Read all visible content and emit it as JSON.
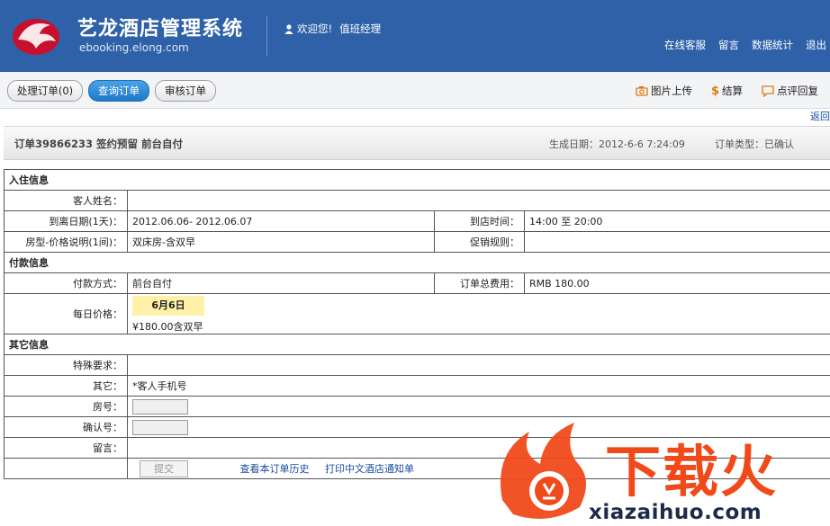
{
  "header": {
    "title": "艺龙酒店管理系统",
    "subtitle": "ebooking.elong.com",
    "welcome": "欢迎您!",
    "user": "值班经理",
    "nav": [
      "在线客服",
      "留言",
      "数据统计",
      "退出"
    ]
  },
  "toolbar": {
    "buttons": [
      "处理订单(0)",
      "查询订单",
      "审核订单"
    ],
    "tools": [
      {
        "label": "图片上传",
        "icon": "camera-icon"
      },
      {
        "label": "结算",
        "icon": "dollar-icon"
      },
      {
        "label": "点评回复",
        "icon": "comment-icon"
      }
    ],
    "back": "返回"
  },
  "order": {
    "summary": "订单39866233  签约预留  前台自付",
    "created": "生成日期：2012-6-6 7:24:09",
    "type": "订单类型：已确认"
  },
  "sections": {
    "checkin": "入住信息",
    "payment": "付款信息",
    "other": "其它信息"
  },
  "fields": {
    "guest_name_label": "客人姓名：",
    "guest_name": "",
    "dates_label": "到离日期(1天)：",
    "dates": "2012.06.06- 2012.06.07",
    "arrival_label": "到店时间：",
    "arrival": "14:00 至 20:00",
    "room_label": "房型-价格说明(1间)：",
    "room": "双床房-含双早",
    "promo_label": "促销规则：",
    "promo": "",
    "pay_method_label": "付款方式：",
    "pay_method": "前台自付",
    "total_label": "订单总费用：",
    "total": "RMB 180.00",
    "daily_label": "每日价格：",
    "daily_date": "6月6日",
    "daily_price": "¥180.00含双早",
    "special_label": "特殊要求：",
    "special": "",
    "other_label": "其它：",
    "other": "*客人手机号",
    "room_no_label": "房号：",
    "confirm_label": "确认号：",
    "message_label": "留言：",
    "message": ""
  },
  "footer": {
    "submit": "提交",
    "history": "查看本订单历史",
    "print": "打印中文酒店通知单"
  },
  "watermark": {
    "brand": "下载火",
    "domain": "xiazaihuo.com"
  }
}
